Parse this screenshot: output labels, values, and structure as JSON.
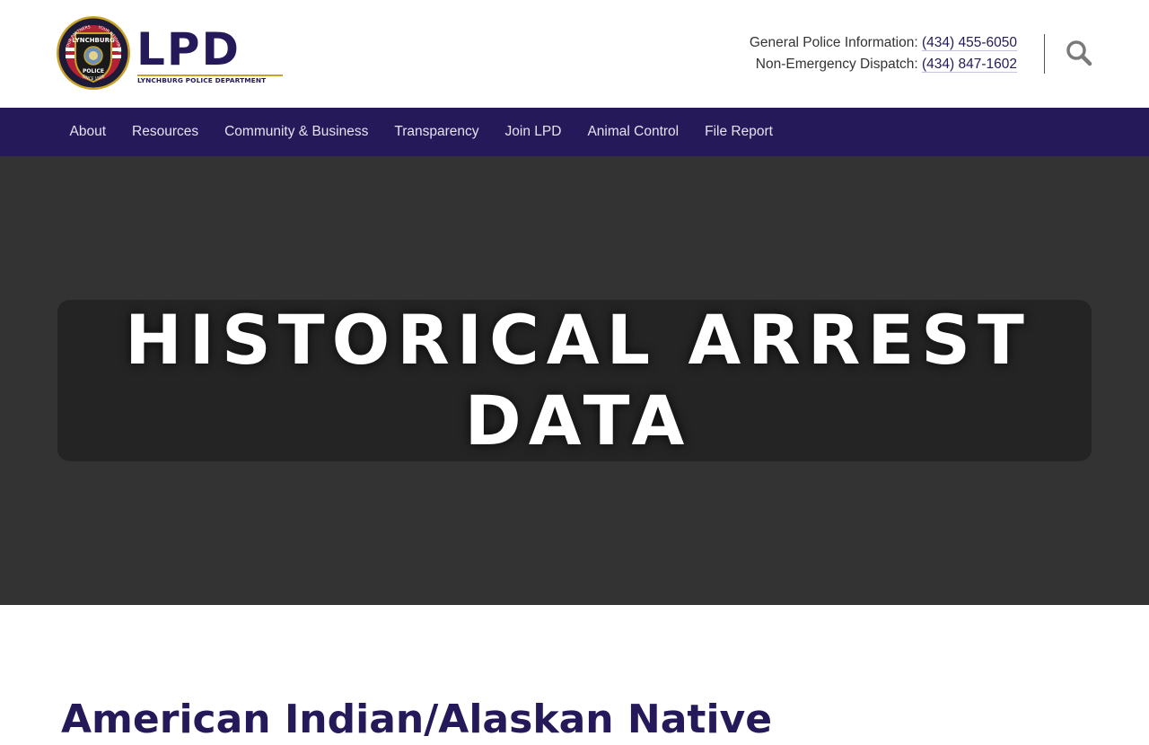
{
  "header": {
    "logo": {
      "wordmark": "LPD",
      "subtitle": "LYNCHBURG POLICE DEPARTMENT",
      "badge_top_text": "LYNCHBURG",
      "badge_bottom_text": "POLICE",
      "badge_ring_left": "YOUR PARTNERS",
      "badge_ring_right": "YOUR NEIGHBORS",
      "badge_since": "SINCE 1806"
    },
    "contact": {
      "general_label": "General Police Information:",
      "general_phone": "(434) 455-6050",
      "dispatch_label": "Non-Emergency Dispatch:",
      "dispatch_phone": "(434) 847-1602"
    },
    "search_icon": "search-icon"
  },
  "nav": {
    "items": [
      "About",
      "Resources",
      "Community & Business",
      "Transparency",
      "Join LPD",
      "Animal Control",
      "File Report"
    ]
  },
  "hero": {
    "title_line1": "HISTORICAL ARREST",
    "title_line2": "DATA"
  },
  "content": {
    "section_heading": "American Indian/Alaskan Native"
  },
  "colors": {
    "brand": "#25195a",
    "hero_bg": "#333333",
    "hero_box": "#242424",
    "accent_gold": "#c9a227"
  }
}
